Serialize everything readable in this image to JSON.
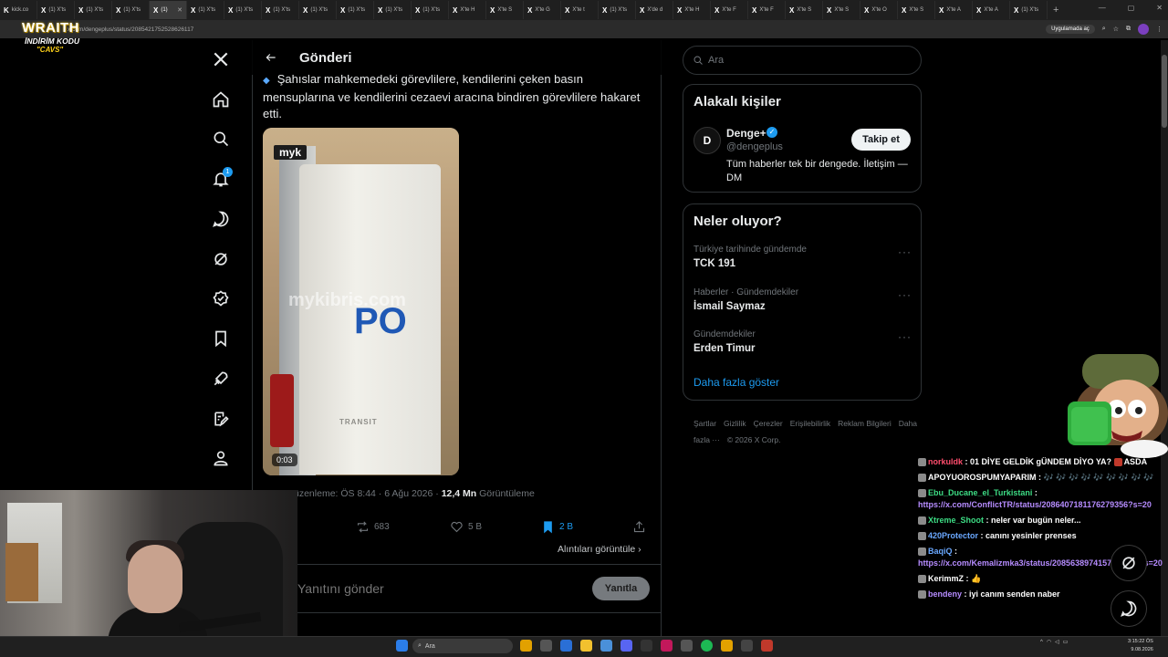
{
  "browser": {
    "tabs": [
      {
        "label": "kick.co",
        "icon": "K"
      },
      {
        "label": "(1) X'ts",
        "icon": "X"
      },
      {
        "label": "(1) X'ts",
        "icon": "X"
      },
      {
        "label": "(1) X'ts",
        "icon": "X"
      },
      {
        "label": "(1)",
        "icon": "X",
        "active": true
      },
      {
        "label": "(1) X'ts",
        "icon": "X"
      },
      {
        "label": "(1) X'ts",
        "icon": "X"
      },
      {
        "label": "(1) X'ts",
        "icon": "X"
      },
      {
        "label": "(1) X'ts",
        "icon": "X"
      },
      {
        "label": "(1) X'ts",
        "icon": "X"
      },
      {
        "label": "(1) X'ts",
        "icon": "X"
      },
      {
        "label": "(1) X'ts",
        "icon": "X"
      },
      {
        "label": "X'te H",
        "icon": "X"
      },
      {
        "label": "X'te S",
        "icon": "X"
      },
      {
        "label": "X'te G",
        "icon": "X"
      },
      {
        "label": "X'te t",
        "icon": "X"
      },
      {
        "label": "(1) X'ts",
        "icon": "X"
      },
      {
        "label": "X'de d",
        "icon": "X"
      },
      {
        "label": "X'te H",
        "icon": "X"
      },
      {
        "label": "X'te F",
        "icon": "X"
      },
      {
        "label": "X'te F",
        "icon": "X"
      },
      {
        "label": "X'te S",
        "icon": "X"
      },
      {
        "label": "X'te S",
        "icon": "X"
      },
      {
        "label": "X'te O",
        "icon": "X"
      },
      {
        "label": "X'te S",
        "icon": "X"
      },
      {
        "label": "X'te A",
        "icon": "X"
      },
      {
        "label": "X'te A",
        "icon": "X"
      },
      {
        "label": "(1) X'ts",
        "icon": "X"
      }
    ],
    "url": "x.com/dengeplus/status/2085421752528626117",
    "open_app_label": "Uygulamada aç"
  },
  "overlay": {
    "brand": "WRAITH",
    "promo_line1": "İNDİRİM KODU",
    "promo_line2": "\"CAVS\""
  },
  "nav": {
    "notification_count": "1"
  },
  "post": {
    "page_title": "Gönderi",
    "text": "Şahıslar mahkemedeki görevlilere, kendilerini çeken basın mensuplarına ve kendilerini cezaevi aracına bindiren görevlilere hakaret etti.",
    "media_badge": "myk",
    "media_watermark": "mykibris.com",
    "media_sign": "PO",
    "media_model": "TRANSIT",
    "video_duration": "0:03",
    "meta_prefix": "üzenleme: ÖS 8:44 · 6 Ağu 2026 · ",
    "views_count": "12,4 Mn",
    "views_label": " Görüntüleme",
    "reposts": "683",
    "likes": "5 B",
    "bookmarks": "2 B",
    "quotes_link": "Alıntıları görüntüle",
    "reply_placeholder": "Yanıtını gönder",
    "reply_button": "Yanıtla"
  },
  "sidebar": {
    "search_placeholder": "Ara",
    "related_title": "Alakalı kişiler",
    "account": {
      "avatar_letter": "D",
      "name": "Denge+",
      "handle": "@dengeplus",
      "bio": "Tüm haberler tek bir dengede. İletişim — DM",
      "follow_label": "Takip et"
    },
    "trends_title": "Neler oluyor?",
    "trends": [
      {
        "context": "Türkiye tarihinde gündemde",
        "name": "TCK 191"
      },
      {
        "context": "Haberler · Gündemdekiler",
        "name": "İsmail Saymaz"
      },
      {
        "context": "Gündemdekiler",
        "name": "Erden Timur"
      }
    ],
    "show_more": "Daha fazla göster",
    "footer": [
      "Şartlar",
      "Gizlilik",
      "Çerezler",
      "Erişilebilirlik",
      "Reklam Bilgileri",
      "Daha fazla ···",
      "© 2026 X Corp."
    ]
  },
  "chat": [
    {
      "user": "norkuldk",
      "color": "#ff4d6d",
      "text": "01 DİYE GELDİK gÜNDEM DİYO YA?",
      "suffix": "ASDA"
    },
    {
      "user": "APOYUOROSPUMYAPARIM",
      "color": "#ffffff",
      "text": "🎶 🎶 🎶 🎶 🎶 🎶 🎶 🎶 🎶"
    },
    {
      "user": "Ebu_Ducane_el_Turkistani",
      "color": "#3ddc84",
      "text": "",
      "link": "https://x.com/ConflictTR/status/2086407181176279356?s=20"
    },
    {
      "user": "Xtreme_Shoot",
      "color": "#3ddc84",
      "text": "neler var bugün neler..."
    },
    {
      "user": "420Protector",
      "color": "#6aa8ff",
      "text": "canını yesinler prenses"
    },
    {
      "user": "BaqiQ",
      "color": "#6aa8ff",
      "text": "",
      "link": "https://x.com/Kemalizmka3/status/2085638974157086530?s=20"
    },
    {
      "user": "KerimmZ",
      "color": "#ffffff",
      "text": "👍"
    },
    {
      "user": "bendeny",
      "color": "#b68cff",
      "text": "iyi canım senden naber"
    }
  ],
  "taskbar": {
    "search_label": "Ara",
    "time": "3:15:22 ÖS",
    "date": "9.08.2026"
  },
  "colors": {
    "accent": "#1d9bf0",
    "background": "#000000",
    "border": "#2f3336",
    "muted": "#71767b"
  }
}
